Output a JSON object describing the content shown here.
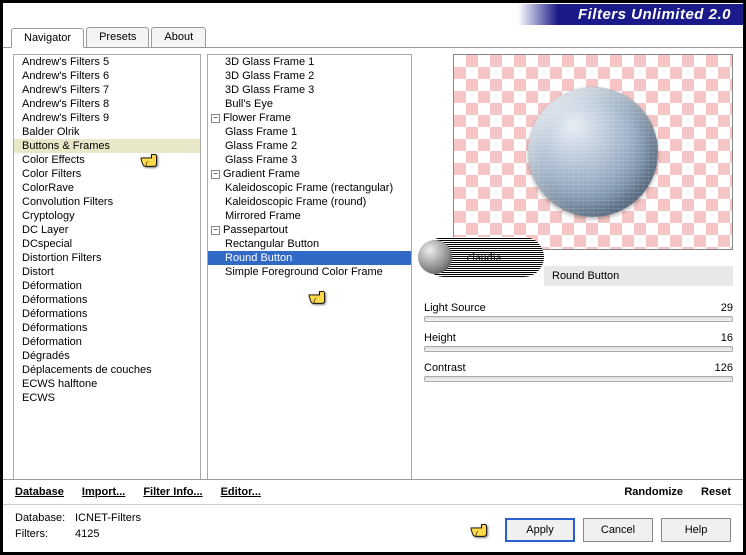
{
  "title": "Filters Unlimited 2.0",
  "tabs": [
    "Navigator",
    "Presets",
    "About"
  ],
  "categories": [
    "Andrew's Filters 5",
    "Andrew's Filters 6",
    "Andrew's Filters 7",
    "Andrew's Filters 8",
    "Andrew's Filters 9",
    "Balder Olrik",
    "Buttons & Frames",
    "Color Effects",
    "Color Filters",
    "ColorRave",
    "Convolution Filters",
    "Cryptology",
    "DC Layer",
    "DCspecial",
    "Distortion Filters",
    "Distort",
    "Déformation",
    "Déformations",
    "Déformations",
    "Déformations",
    "Déformation",
    "Dégradés",
    "Déplacements de couches",
    "ECWS halftone",
    "ECWS"
  ],
  "selected_category_index": 6,
  "filters_tree": [
    {
      "label": "3D Glass Frame 1",
      "type": "leaf"
    },
    {
      "label": "3D Glass Frame 2",
      "type": "leaf"
    },
    {
      "label": "3D Glass Frame 3",
      "type": "leaf"
    },
    {
      "label": "Bull's Eye",
      "type": "leaf"
    },
    {
      "label": "Flower Frame",
      "type": "group"
    },
    {
      "label": "Glass Frame 1",
      "type": "leaf"
    },
    {
      "label": "Glass Frame 2",
      "type": "leaf"
    },
    {
      "label": "Glass Frame 3",
      "type": "leaf"
    },
    {
      "label": "Gradient Frame",
      "type": "group"
    },
    {
      "label": "Kaleidoscopic Frame (rectangular)",
      "type": "leaf"
    },
    {
      "label": "Kaleidoscopic Frame (round)",
      "type": "leaf"
    },
    {
      "label": "Mirrored Frame",
      "type": "leaf"
    },
    {
      "label": "Passepartout",
      "type": "group"
    },
    {
      "label": "Rectangular Button",
      "type": "leaf"
    },
    {
      "label": "Round Button",
      "type": "leaf",
      "selected": true
    },
    {
      "label": "Simple Foreground Color Frame",
      "type": "leaf"
    }
  ],
  "selected_filter_name": "Round Button",
  "params": [
    {
      "name": "Light Source",
      "value": 29
    },
    {
      "name": "Height",
      "value": 16
    },
    {
      "name": "Contrast",
      "value": 126
    }
  ],
  "toolbar": {
    "database": "Database",
    "import": "Import...",
    "filter_info": "Filter Info...",
    "editor": "Editor...",
    "randomize": "Randomize",
    "reset": "Reset"
  },
  "footer": {
    "db_label": "Database:",
    "db_value": "ICNET-Filters",
    "filters_label": "Filters:",
    "filters_value": "4125"
  },
  "buttons": {
    "apply": "Apply",
    "cancel": "Cancel",
    "help": "Help"
  },
  "watermark": "claudia"
}
